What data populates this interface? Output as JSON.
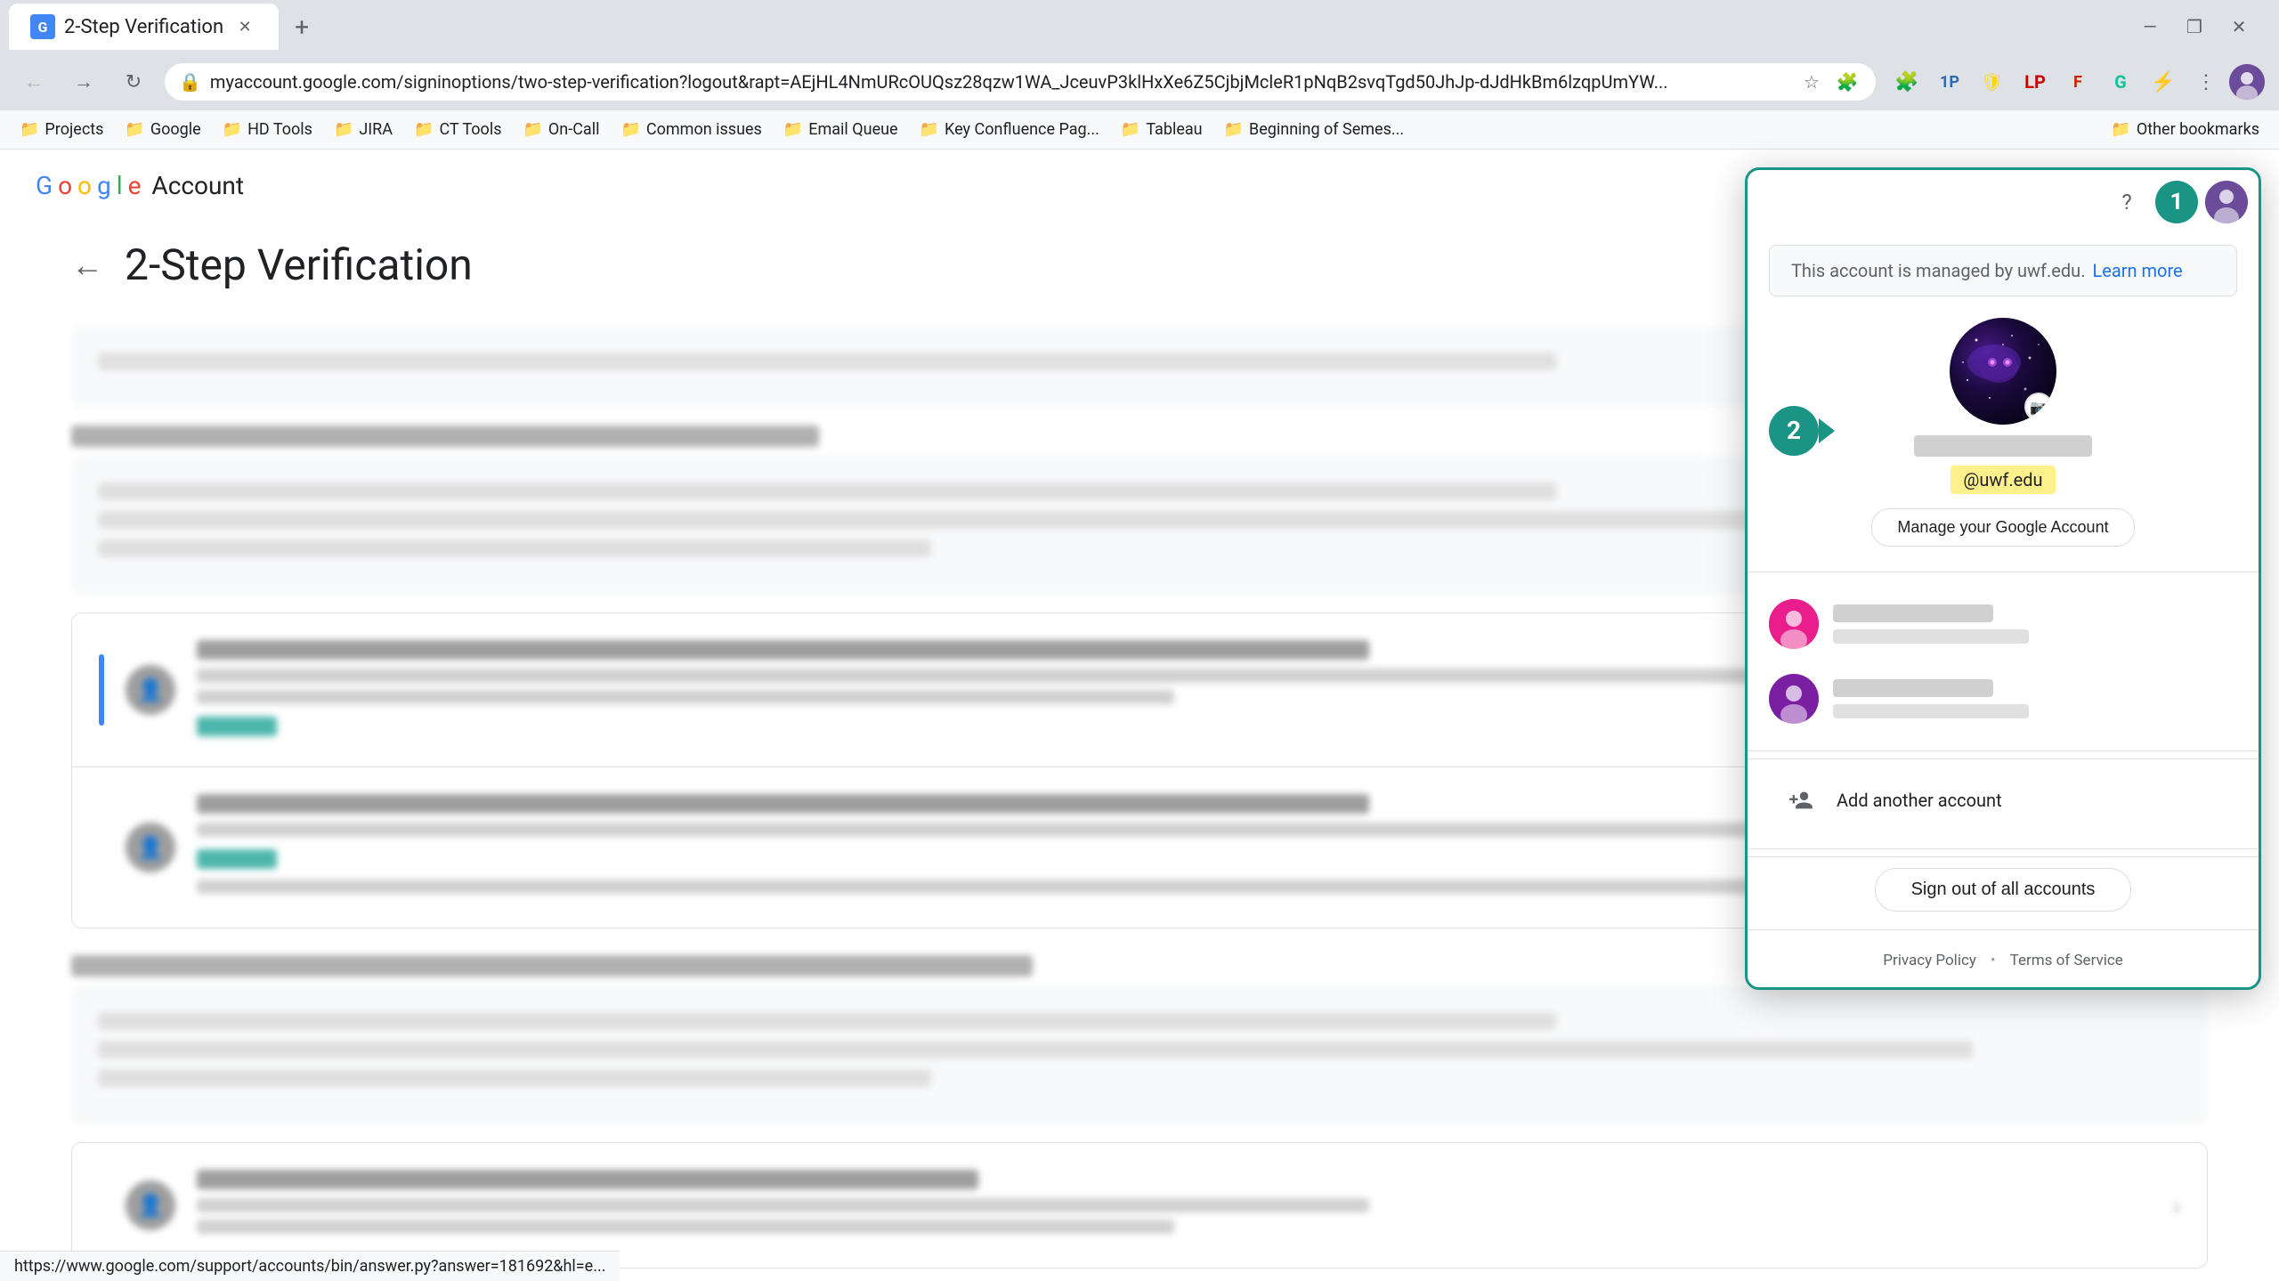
{
  "browser": {
    "tab": {
      "title": "2-Step Verification",
      "favicon_letter": "G"
    },
    "url": "myaccount.google.com/signinoptions/two-step-verification?logout&rapt=AEjHL4NmURcOUQsz28qzw1WA_JceuvP3klHxXe6Z5CjbjMcleR1pNqB2svqTgd50JhJp-dJdHkBm6lzqpUmYW...",
    "window_controls": {
      "minimize": "—",
      "maximize": "□",
      "close": "✕"
    }
  },
  "bookmarks": [
    {
      "label": "Projects",
      "icon": "folder"
    },
    {
      "label": "Google",
      "icon": "folder"
    },
    {
      "label": "HD Tools",
      "icon": "folder"
    },
    {
      "label": "JIRA",
      "icon": "folder"
    },
    {
      "label": "CT Tools",
      "icon": "folder"
    },
    {
      "label": "On-Call",
      "icon": "folder"
    },
    {
      "label": "Common issues",
      "icon": "folder"
    },
    {
      "label": "Email Queue",
      "icon": "folder"
    },
    {
      "label": "Key Confluence Pag...",
      "icon": "folder"
    },
    {
      "label": "Tableau",
      "icon": "folder"
    },
    {
      "label": "Beginning of Semes...",
      "icon": "folder"
    },
    {
      "label": "Other bookmarks",
      "icon": "folder"
    }
  ],
  "page": {
    "header": {
      "google_text": "Google",
      "account_text": "Account"
    },
    "title": "2-Step Verification",
    "back_arrow": "←"
  },
  "account_dropdown": {
    "managed_notice": "This account is managed by uwf.edu.",
    "learn_more": "Learn more",
    "account_number": "2",
    "header_number": "1",
    "email_badge": "@uwf.edu",
    "manage_btn": "Manage your Google Account",
    "add_account_label": "Add another account",
    "sign_out_label": "Sign out of all accounts",
    "privacy_policy": "Privacy Policy",
    "terms_of_service": "Terms of Service",
    "footer_dot": "•"
  },
  "status_bar": {
    "url": "https://www.google.com/support/accounts/bin/answer.py?answer=181692&hl=e..."
  }
}
